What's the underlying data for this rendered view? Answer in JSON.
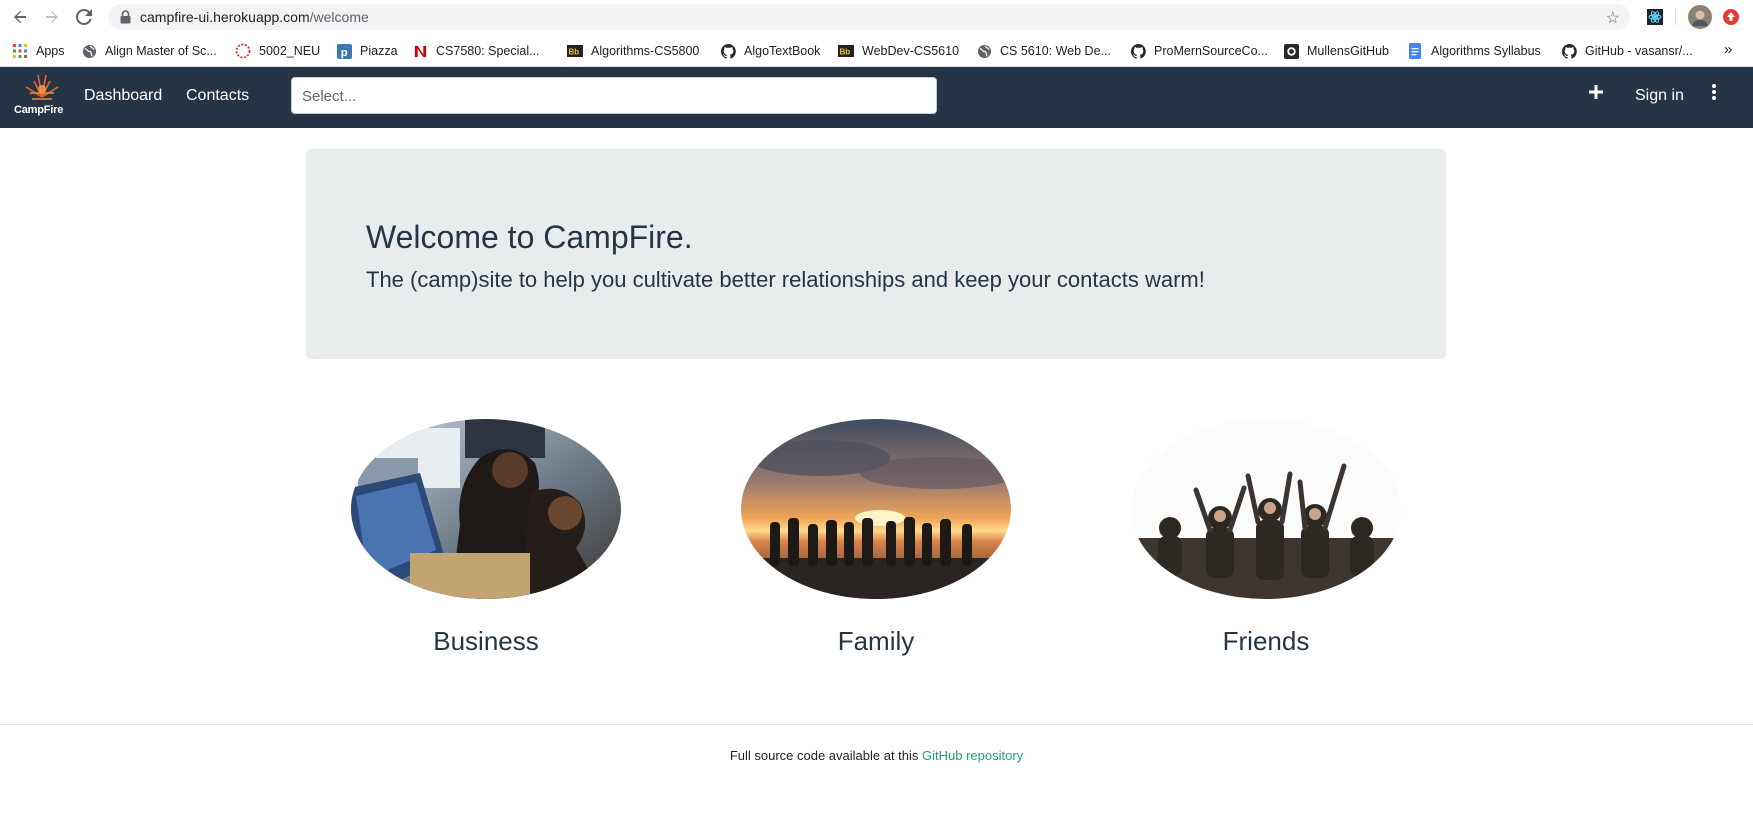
{
  "browser": {
    "url_host": "campfire-ui.herokuapp.com",
    "url_path": "/welcome",
    "bookmarks": [
      {
        "label": "Apps",
        "icon": "apps-grid-icon"
      },
      {
        "label": "Align Master of Sc...",
        "icon": "globe-icon"
      },
      {
        "label": "5002_NEU",
        "icon": "dotted-circle-icon"
      },
      {
        "label": "Piazza",
        "icon": "piazza-icon"
      },
      {
        "label": "CS7580: Special...",
        "icon": "northeastern-icon"
      },
      {
        "label": "Algorithms-CS5800",
        "icon": "blackboard-icon"
      },
      {
        "label": "AlgoTextBook",
        "icon": "github-icon"
      },
      {
        "label": "WebDev-CS5610",
        "icon": "blackboard-icon"
      },
      {
        "label": "CS 5610: Web De...",
        "icon": "globe-icon"
      },
      {
        "label": "ProMernSourceCo...",
        "icon": "github-icon"
      },
      {
        "label": "MullensGitHub",
        "icon": "github-icon"
      },
      {
        "label": "Algorithms Syllabus",
        "icon": "google-docs-icon"
      },
      {
        "label": "GitHub - vasansr/...",
        "icon": "github-icon"
      }
    ],
    "overflow": "»"
  },
  "navbar": {
    "brand": "CampFire",
    "links": [
      "Dashboard",
      "Contacts"
    ],
    "search_placeholder": "Select...",
    "sign_in": "Sign in"
  },
  "jumbotron": {
    "title": "Welcome to CampFire.",
    "subtitle": "The (camp)site to help you cultivate better relationships and keep your contacts warm!"
  },
  "categories": [
    {
      "label": "Business"
    },
    {
      "label": "Family"
    },
    {
      "label": "Friends"
    }
  ],
  "footer": {
    "text": "Full source code available at this ",
    "link": "GitHub repository"
  },
  "colors": {
    "navbar": "#263545",
    "jumbotron": "#e9eced",
    "link": "#18a37e"
  }
}
